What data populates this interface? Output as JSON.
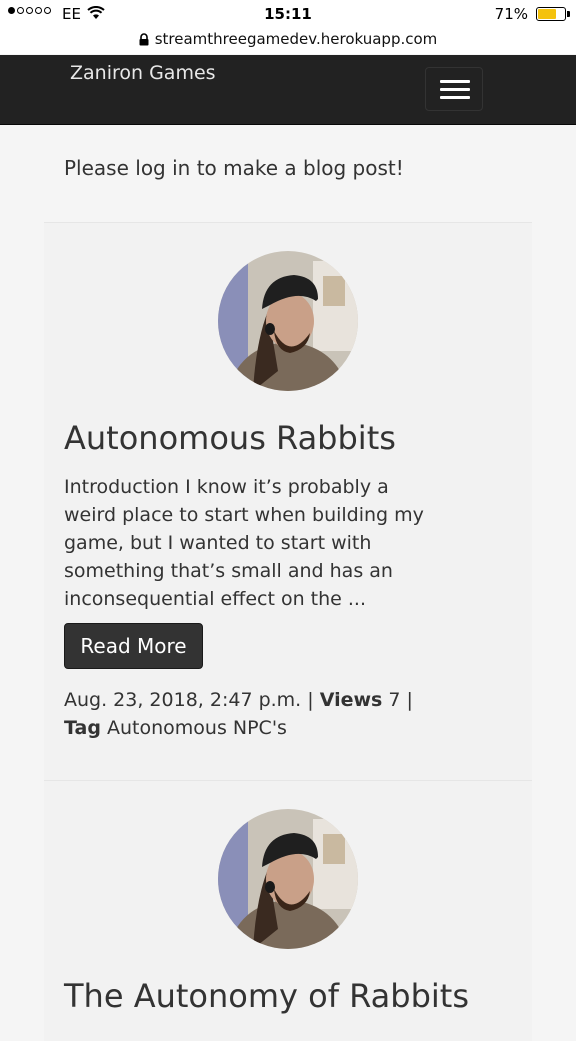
{
  "status_bar": {
    "carrier": "EE",
    "time": "15:11",
    "battery_percent": "71%",
    "battery_level": 0.71,
    "battery_color": "#f4c20d"
  },
  "browser": {
    "url": "streamthreegamedev.herokuapp.com"
  },
  "navbar": {
    "brand": "Zaniron Games",
    "background": "#222222"
  },
  "main": {
    "login_message": "Please log in to make a blog post!",
    "posts": [
      {
        "title": "Autonomous Rabbits",
        "excerpt": "Introduction I know it’s probably a weird place to start when building my game, but I wanted to start with something that’s small and has an inconsequential effect on the ...",
        "read_more_label": "Read More",
        "date": "Aug. 23, 2018, 2:47 p.m.",
        "views_label": "Views",
        "views": "7",
        "tag_label": "Tag",
        "tag": "Autonomous NPC's"
      },
      {
        "title": "The Autonomy of Rabbits"
      }
    ]
  }
}
